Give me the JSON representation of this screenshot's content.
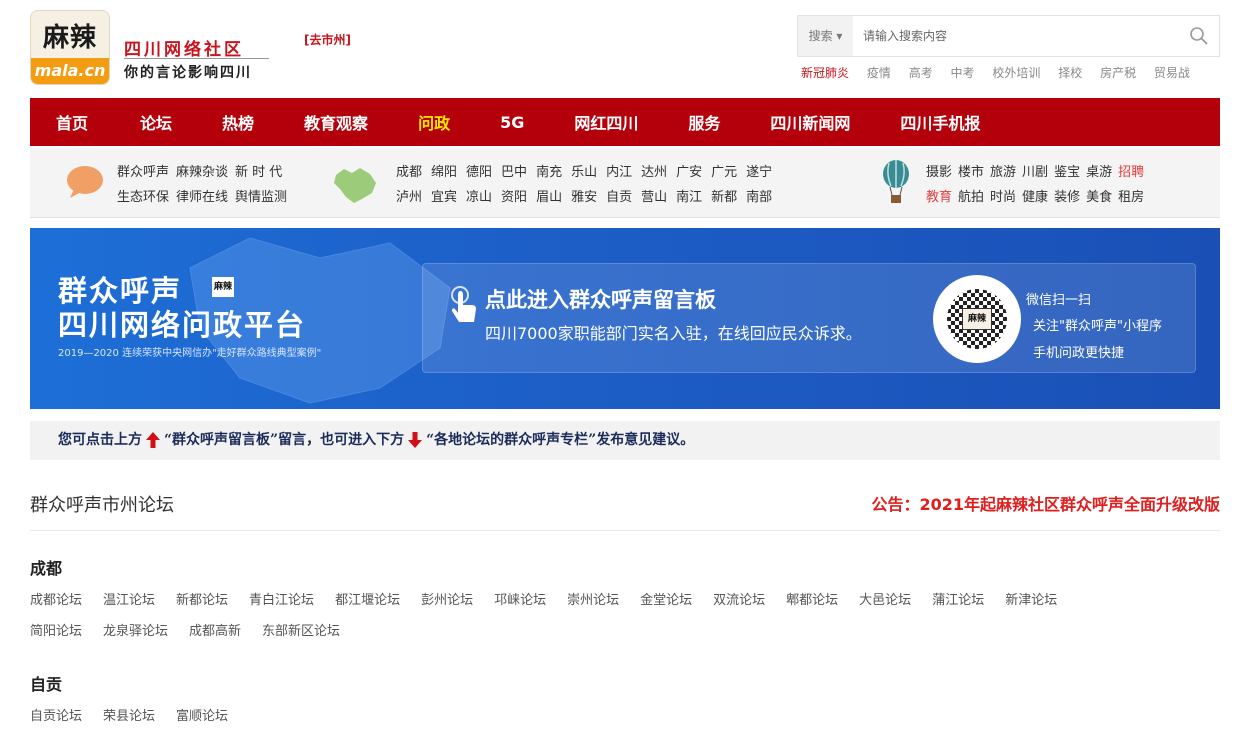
{
  "logo": {
    "top": "麻辣",
    "bottom": "mala.cn"
  },
  "site": {
    "name": "四川网络社区",
    "slogan": "你的言论影响四川",
    "city_link": "[去市州]"
  },
  "search": {
    "select_label": "搜索",
    "placeholder": "请输入搜索内容"
  },
  "hot_words": [
    "新冠肺炎",
    "疫情",
    "高考",
    "中考",
    "校外培训",
    "择校",
    "房产税",
    "贸易战"
  ],
  "nav": [
    "首页",
    "论坛",
    "热榜",
    "教育观察",
    "问政",
    "5G",
    "网红四川",
    "服务",
    "四川新闻网",
    "四川手机报"
  ],
  "sub_panel": {
    "left_row1": [
      "群众呼声",
      "麻辣杂谈",
      "新 时 代"
    ],
    "left_row2": [
      "生态环保",
      "律师在线",
      "舆情监测"
    ],
    "mid_row1": [
      "成都",
      "绵阳",
      "德阳",
      "巴中",
      "南充",
      "乐山",
      "内江",
      "达州",
      "广安",
      "广元",
      "遂宁"
    ],
    "mid_row2": [
      "泸州",
      "宜宾",
      "凉山",
      "资阳",
      "眉山",
      "雅安",
      "自贡",
      "营山",
      "南江",
      "新都",
      "南部"
    ],
    "right_row1": [
      "摄影",
      "楼市",
      "旅游",
      "川剧",
      "鉴宝",
      "桌游",
      "招聘"
    ],
    "right_row2": [
      "教育",
      "航拍",
      "时尚",
      "健康",
      "装修",
      "美食",
      "租房"
    ]
  },
  "banner": {
    "title1": "群众呼声",
    "title2": "四川网络问政平台",
    "sub": "2019—2020 连续荣获中央网信办\"走好群众路线典型案例\"",
    "badge": "麻辣",
    "heading": "点此进入群众呼声留言板",
    "text": "四川7000家职能部门实名入驻，在线回应民众诉求。",
    "qr_label": "麻辣",
    "qr_line1": "微信扫一扫",
    "qr_line2": "关注\"群众呼声\"小程序",
    "qr_line3": "手机问政更快捷"
  },
  "notice_bar": {
    "part1": "您可点击上方",
    "part2": "“群众呼声留言板”留言，也可进入下方",
    "part3": "“各地论坛的群众呼声专栏”发布意见建议。"
  },
  "section": {
    "title": "群众呼声市州论坛",
    "notice": "公告：2021年起麻辣社区群众呼声全面升级改版"
  },
  "cities": [
    {
      "name": "成都",
      "rows": [
        [
          "成都论坛",
          "温江论坛",
          "新都论坛",
          "青白江论坛",
          "都江堰论坛",
          "彭州论坛",
          "邛崃论坛",
          "崇州论坛",
          "金堂论坛",
          "双流论坛",
          "郫都论坛",
          "大邑论坛",
          "蒲江论坛",
          "新津论坛"
        ],
        [
          "简阳论坛",
          "龙泉驿论坛",
          "成都高新",
          "东部新区论坛"
        ]
      ]
    },
    {
      "name": "自贡",
      "rows": [
        [
          "自贡论坛",
          "荣县论坛",
          "富顺论坛"
        ]
      ]
    }
  ],
  "colors": {
    "nav": "#b4000b",
    "accent": "#c8151d",
    "nav_active": "#ffe600",
    "banner": "#1d5fc8"
  }
}
